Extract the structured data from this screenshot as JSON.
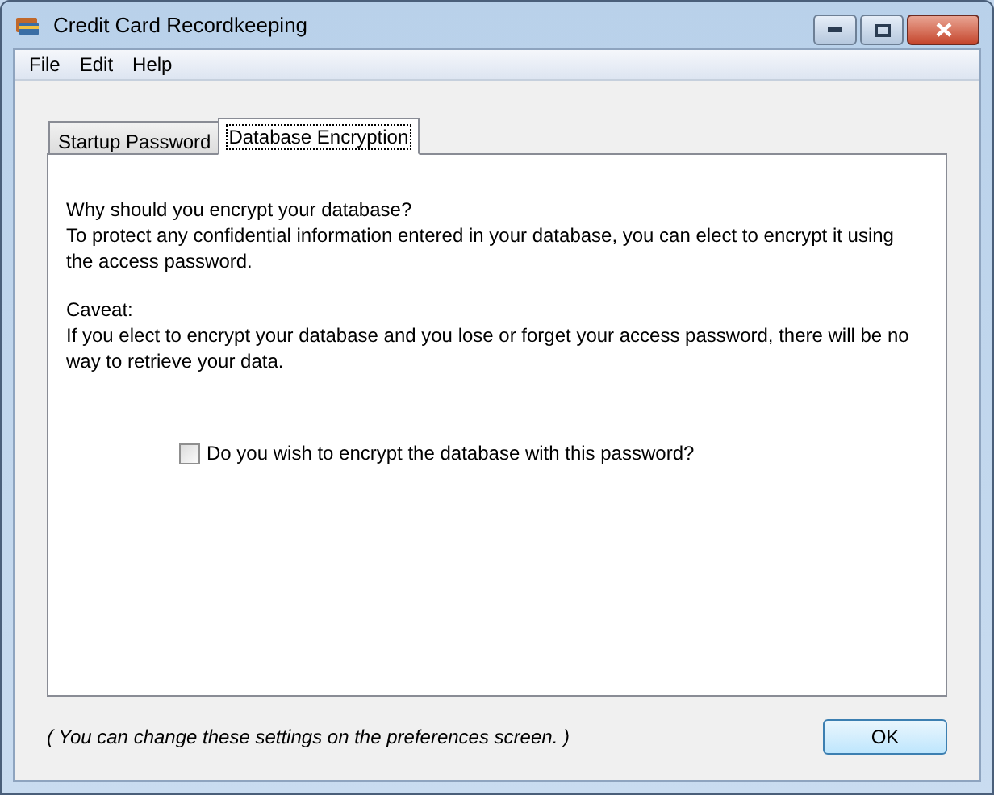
{
  "window": {
    "title": "Credit Card Recordkeeping"
  },
  "menu": [
    "File",
    "Edit",
    "Help"
  ],
  "tabs": [
    {
      "label": "Startup Password",
      "selected": false
    },
    {
      "label": "Database Encryption",
      "selected": true
    }
  ],
  "sections": [
    {
      "heading": "Why should you encrypt your database?",
      "body": "To protect any confidential information entered in your database, you can elect to encrypt it using the access password."
    },
    {
      "heading": "Caveat:",
      "body": "If you elect to encrypt your database and you lose or forget your access password, there will be no way to retrieve your data."
    }
  ],
  "checkbox": {
    "label": "Do you wish to encrypt the database with this password?",
    "checked": false
  },
  "footer_note": "( You can change these settings on the preferences screen. )",
  "ok_button": "OK"
}
